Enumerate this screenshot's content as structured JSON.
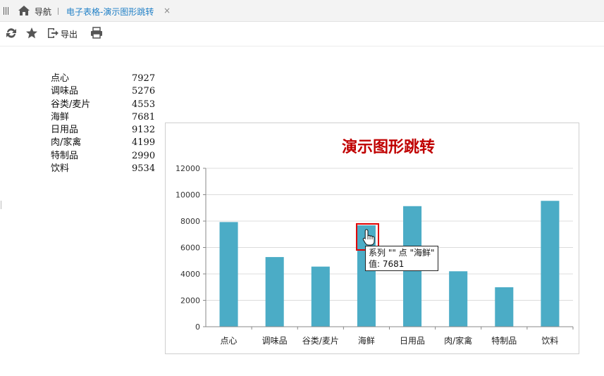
{
  "tabbar": {
    "nav_label": "导航",
    "active_tab": "电子表格-演示图形跳转",
    "close_glyph": "×"
  },
  "toolbar": {
    "icons": [
      "refresh-icon",
      "star-icon",
      "export-icon",
      "print-icon"
    ],
    "export_label": "导出"
  },
  "data_list": [
    {
      "category": "点心",
      "value": "7927"
    },
    {
      "category": "调味品",
      "value": "5276"
    },
    {
      "category": "谷类/麦片",
      "value": "4553"
    },
    {
      "category": "海鲜",
      "value": "7681"
    },
    {
      "category": "日用品",
      "value": "9132"
    },
    {
      "category": "肉/家禽",
      "value": "4199"
    },
    {
      "category": "特制品",
      "value": "2990"
    },
    {
      "category": "饮料",
      "value": "9534"
    }
  ],
  "tooltip": {
    "line1": "系列 \"\" 点 \"海鲜\"",
    "line2": "值: 7681"
  },
  "colors": {
    "bar": "#4bacc6",
    "title": "#c00000",
    "tab_active": "#1f7fc6",
    "highlight": "#e00000"
  },
  "chart_data": {
    "type": "bar",
    "title": "演示图形跳转",
    "categories": [
      "点心",
      "调味品",
      "谷类/麦片",
      "海鲜",
      "日用品",
      "肉/家禽",
      "特制品",
      "饮料"
    ],
    "values": [
      7927,
      5276,
      4553,
      7681,
      9132,
      4199,
      2990,
      9534
    ],
    "ylim": [
      0,
      12000
    ],
    "yticks": [
      0,
      2000,
      4000,
      6000,
      8000,
      10000,
      12000
    ],
    "grid": true,
    "legend": "none"
  }
}
